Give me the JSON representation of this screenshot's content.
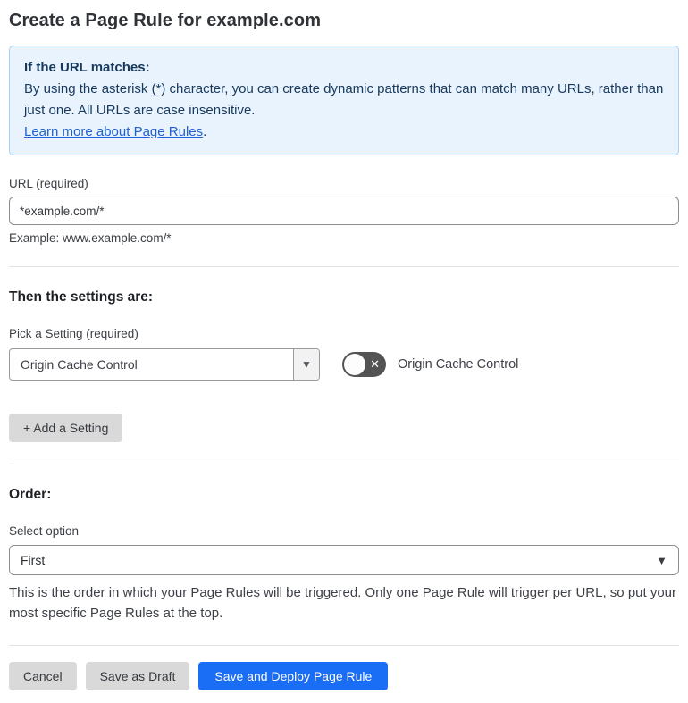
{
  "page": {
    "title": "Create a Page Rule for example.com"
  },
  "info_box": {
    "heading": "If the URL matches:",
    "body": "By using the asterisk (*) character, you can create dynamic patterns that can match many URLs, rather than just one. All URLs are case insensitive.",
    "link_text": "Learn more about Page Rules",
    "link_suffix": "."
  },
  "url_field": {
    "label": "URL (required)",
    "value": "*example.com/*",
    "helper": "Example: www.example.com/*"
  },
  "settings_section": {
    "heading": "Then the settings are:",
    "setting_label": "Pick a Setting (required)",
    "setting_value": "Origin Cache Control",
    "toggle_label": "Origin Cache Control",
    "toggle_state": "off",
    "add_setting_label": "+ Add a Setting"
  },
  "order_section": {
    "heading": "Order:",
    "select_label": "Select option",
    "select_value": "First",
    "helper": "This is the order in which your Page Rules will be triggered. Only one Page Rule will trigger per URL, so put your most specific Page Rules at the top."
  },
  "footer": {
    "cancel_label": "Cancel",
    "save_draft_label": "Save as Draft",
    "save_deploy_label": "Save and Deploy Page Rule"
  },
  "icons": {
    "toggle_off_x": "✕",
    "select_arrow": "▼",
    "chevron_down": "▼"
  },
  "colors": {
    "accent_blue": "#1a6ef5",
    "info_background": "#e9f3fd",
    "info_border": "#a7d2f1",
    "info_text": "#17395c",
    "link_blue": "#2061cf",
    "toggle_off_gray": "#535353",
    "button_gray": "#d9d9d9"
  }
}
